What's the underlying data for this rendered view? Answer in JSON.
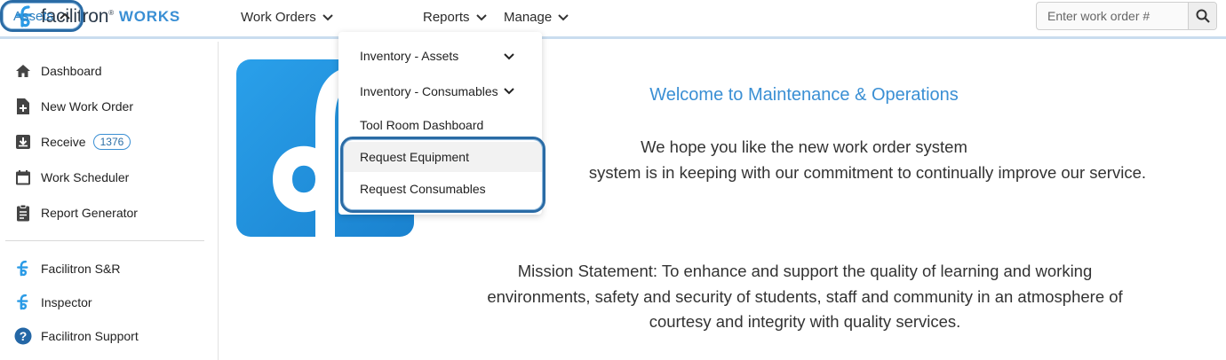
{
  "brand": {
    "name": "facilitron",
    "reg": "®",
    "suffix": "WORKS",
    "accent": "#3a8fd4"
  },
  "nav": {
    "items": [
      {
        "label": "Work Orders"
      },
      {
        "label": "Assets"
      },
      {
        "label": "Reports"
      },
      {
        "label": "Manage"
      }
    ]
  },
  "search": {
    "placeholder": "Enter work order #"
  },
  "sidebar": {
    "items": [
      {
        "label": "Dashboard",
        "icon": "home-icon"
      },
      {
        "label": "New Work Order",
        "icon": "file-plus-icon"
      },
      {
        "label": "Receive",
        "icon": "download-box-icon",
        "badge": "1376"
      },
      {
        "label": "Work Scheduler",
        "icon": "calendar-icon"
      },
      {
        "label": "Report Generator",
        "icon": "clipboard-icon"
      }
    ],
    "apps": [
      {
        "label": "Facilitron S&R",
        "icon": "facilitron-logo-icon"
      },
      {
        "label": "Inspector",
        "icon": "facilitron-logo-icon"
      },
      {
        "label": "Facilitron Support",
        "icon": "help-circle-icon"
      }
    ]
  },
  "assets_menu": {
    "items": [
      {
        "label": "Inventory - Assets",
        "has_submenu": true
      },
      {
        "label": "Inventory - Consumables",
        "has_submenu": true
      },
      {
        "label": "Tool Room Dashboard",
        "has_submenu": false
      },
      {
        "label": "Request Equipment",
        "has_submenu": false
      },
      {
        "label": "Request Consumables",
        "has_submenu": false
      }
    ]
  },
  "main": {
    "welcome": "Welcome to Maintenance & Operations",
    "line1": "We hope you like the new work order system",
    "line2": "system is in keeping with our commitment to continually improve our service.",
    "mission_1": "Mission Statement: To enhance and support the quality of learning and working",
    "mission_2": "environments, safety and security of students, staff and community in an atmosphere of",
    "mission_3": "courtesy and integrity with quality services."
  },
  "colors": {
    "highlight_border": "#2a6ba5",
    "link_blue": "#2d7fc0"
  }
}
